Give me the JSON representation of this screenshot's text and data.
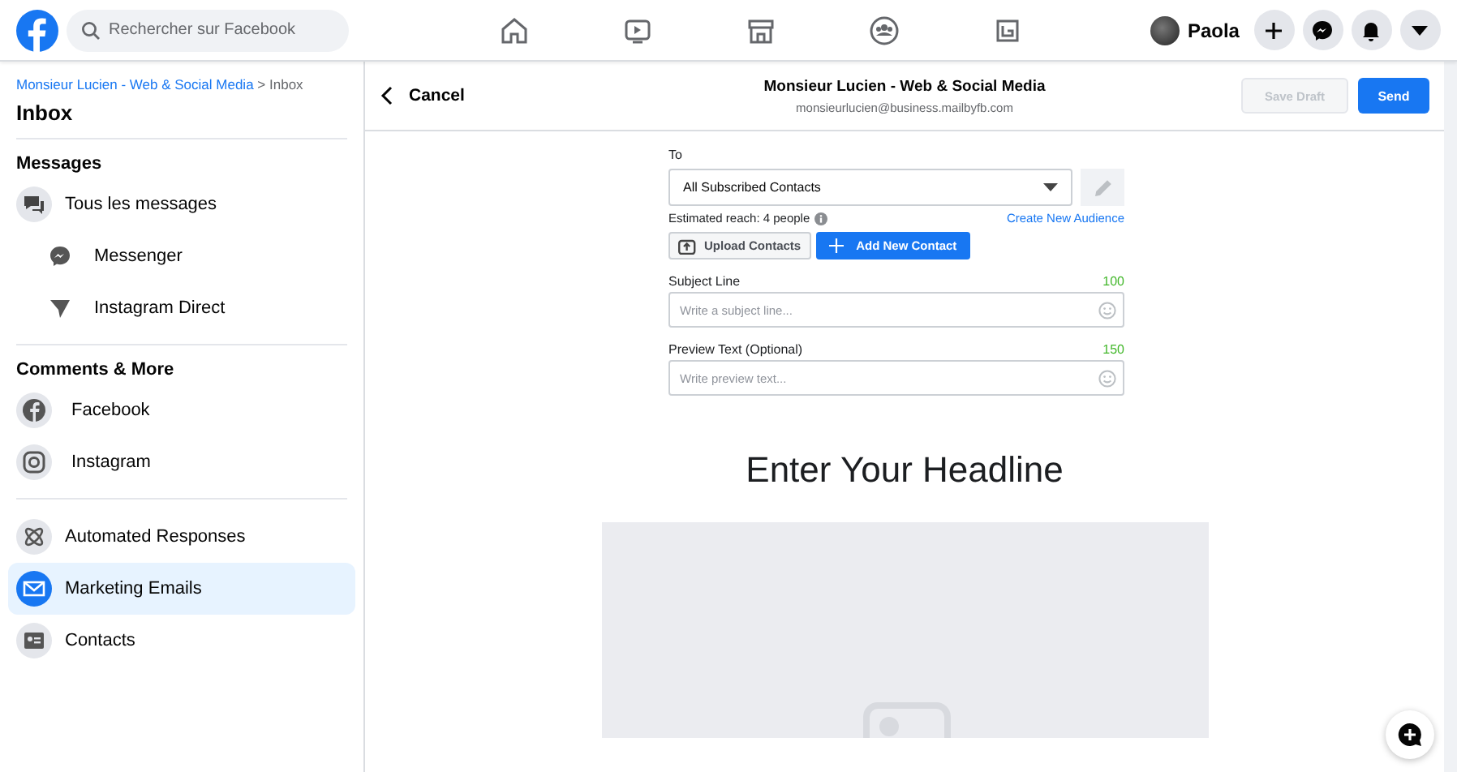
{
  "top_bar": {
    "search": {
      "placeholder": "Rechercher sur Facebook"
    },
    "user": {
      "name": "Paola"
    }
  },
  "sidebar": {
    "breadcrumb": {
      "link": "Monsieur Lucien - Web & Social Media",
      "rest": "> Inbox"
    },
    "title": "Inbox",
    "sections": [
      {
        "heading": "Messages",
        "items": [
          {
            "label": "Tous les messages",
            "kind": "chat",
            "selected": false,
            "children": [
              {
                "label": "Messenger",
                "kind": "messenger",
                "selected": false
              },
              {
                "label": "Instagram Direct",
                "kind": "direct",
                "selected": false
              }
            ]
          }
        ]
      },
      {
        "heading": "Comments & More",
        "items": [
          {
            "label": "Facebook",
            "kind": "facebook",
            "selected": false
          },
          {
            "label": "Instagram",
            "kind": "instagram",
            "selected": false
          }
        ]
      },
      {
        "items": [
          {
            "label": "Automated Responses",
            "kind": "atom",
            "selected": false
          },
          {
            "label": "Marketing Emails",
            "kind": "mail",
            "selected": true
          },
          {
            "label": "Contacts",
            "kind": "card",
            "selected": false
          }
        ]
      }
    ]
  },
  "compose": {
    "cancel": "Cancel",
    "page_name": "Monsieur Lucien - Web & Social Media",
    "email": "monsieurlucien@business.mailbyfb.com",
    "save_draft": {
      "label": "Save Draft",
      "disabled": true
    },
    "send": "Send",
    "to": {
      "label": "To",
      "value": "All Subscribed Contacts"
    },
    "reach": "Estimated reach: 4 people",
    "create_audience": "Create New Audience",
    "upload": "Upload Contacts",
    "add_contact": "Add New Contact",
    "fields": [
      {
        "label": "Subject Line",
        "count": "100",
        "placeholder": "Write a subject line..."
      },
      {
        "label": "Preview Text (Optional)",
        "count": "150",
        "placeholder": "Write preview text..."
      }
    ],
    "headline": "Enter Your Headline"
  }
}
